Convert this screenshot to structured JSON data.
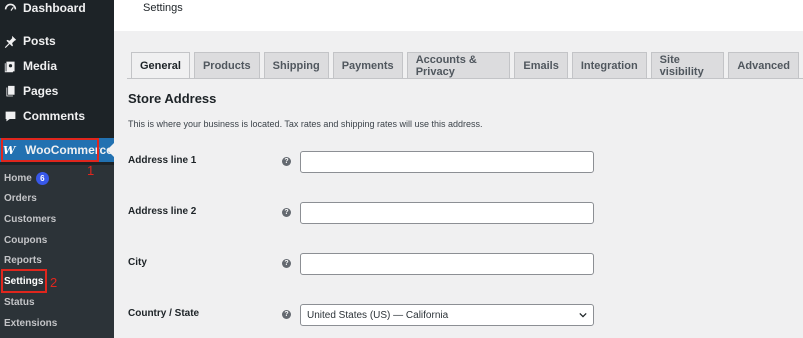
{
  "sidebar": {
    "items": [
      {
        "label": "Dashboard",
        "icon": "dashboard-icon"
      },
      {
        "label": "Posts",
        "icon": "pin-icon"
      },
      {
        "label": "Media",
        "icon": "media-icon"
      },
      {
        "label": "Pages",
        "icon": "pages-icon"
      },
      {
        "label": "Comments",
        "icon": "comments-icon"
      }
    ],
    "woocommerce": {
      "label": "WooCommerce",
      "logo": "W",
      "annotation": "1"
    },
    "submenu": [
      {
        "label": "Home",
        "badge": "6"
      },
      {
        "label": "Orders"
      },
      {
        "label": "Customers"
      },
      {
        "label": "Coupons"
      },
      {
        "label": "Reports"
      },
      {
        "label": "Settings"
      },
      {
        "label": "Status"
      },
      {
        "label": "Extensions"
      }
    ],
    "settings_annotation": "2"
  },
  "header": {
    "title": "Settings"
  },
  "tabs": [
    "General",
    "Products",
    "Shipping",
    "Payments",
    "Accounts & Privacy",
    "Emails",
    "Integration",
    "Site visibility",
    "Advanced"
  ],
  "section": {
    "title": "Store Address",
    "description": "This is where your business is located. Tax rates and shipping rates will use this address."
  },
  "fields": [
    {
      "label": "Address line 1",
      "value": ""
    },
    {
      "label": "Address line 2",
      "value": ""
    },
    {
      "label": "City",
      "value": ""
    },
    {
      "label": "Country / State",
      "value": "United States (US) — California"
    }
  ],
  "help_glyph": "?",
  "colors": {
    "sidebar": "#1d2327",
    "accent": "#2271b1",
    "annotation": "#e0261d",
    "badge": "#3858e9"
  }
}
